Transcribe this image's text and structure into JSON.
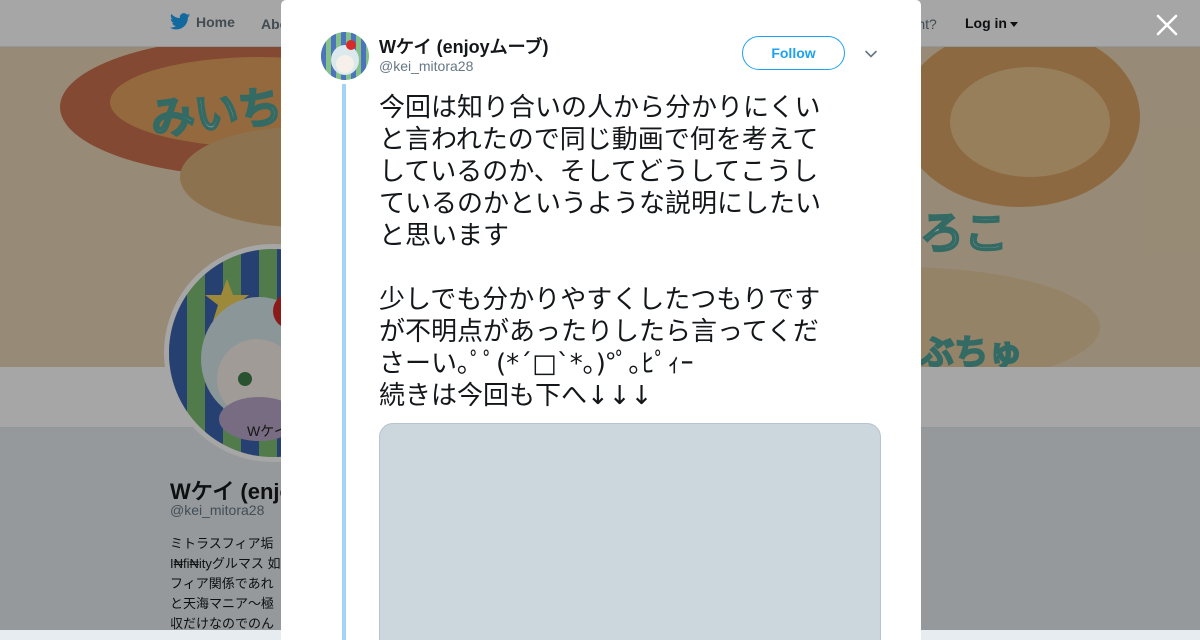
{
  "topbar": {
    "home_label": "Home",
    "about_label": "Abo",
    "account_text": "account?",
    "login_label": "Log in"
  },
  "banner": {
    "text_left": "みいち",
    "text_right": "ろこ",
    "text_bottom": "ぶちゅ"
  },
  "profile": {
    "name": "Wケイ (enjo",
    "handle": "@kei_mitora28",
    "avatar_caption": "Wケイ",
    "bio_lines": [
      "ミトラスフィア垢",
      "I₦fi₦ityグルマス 如",
      "フィア関係であれ",
      "と天海マニア～極",
      "収だけなのでのん"
    ]
  },
  "tweet": {
    "name": "Wケイ (enjoyムーブ)",
    "handle": "@kei_mitora28",
    "follow_label": "Follow",
    "paragraph1": [
      "今回は知り合いの人から分かりにくい",
      "と言われたので同じ動画で何を考えて",
      "しているのか、そしてどうしてこうし",
      "ているのかというような説明にしたい",
      "と思います"
    ],
    "paragraph2": [
      "少しでも分かりやすくしたつもりです",
      "が不明点があったりしたら言ってくだ",
      "さーい｡ﾟﾟ(*´□`*｡)°ﾟ｡ﾋﾟｨｰ",
      "続きは今回も下へ↓↓↓"
    ]
  },
  "colors": {
    "accent": "#1da1f2",
    "thread_line": "#a3d4f7",
    "media_placeholder": "#ccd6dd"
  },
  "icons": [
    "twitter-bird-icon",
    "close-icon",
    "chevron-down-icon",
    "caret-down-icon"
  ]
}
